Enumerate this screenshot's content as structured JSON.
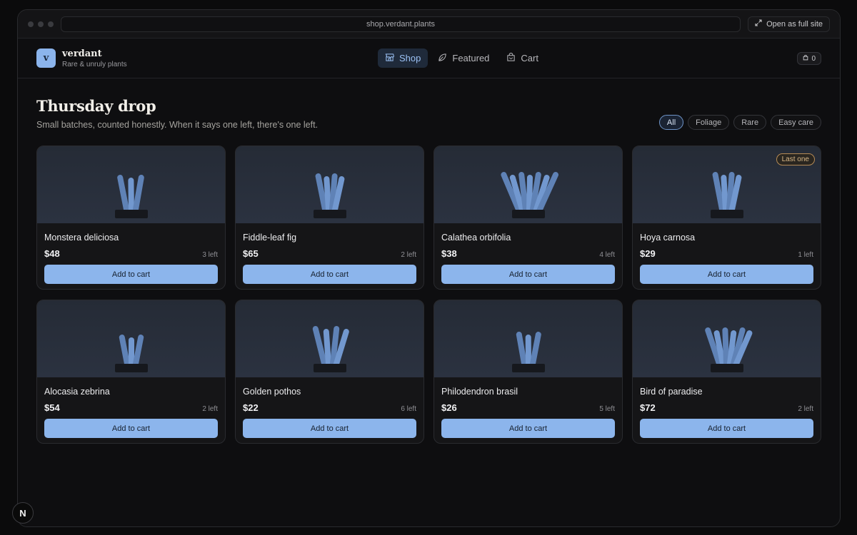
{
  "browser": {
    "url": "shop.verdant.plants",
    "open_full_label": "Open as full site"
  },
  "brand": {
    "logo_letter": "v",
    "name": "verdant",
    "tagline": "Rare & unruly plants"
  },
  "nav": {
    "shop": "Shop",
    "featured": "Featured",
    "cart": "Cart"
  },
  "cart_count": "0",
  "page": {
    "title": "Thursday drop",
    "subtitle": "Small batches, counted honestly. When it says one left, there's one left."
  },
  "filters": [
    "All",
    "Foliage",
    "Rare",
    "Easy care"
  ],
  "add_label": "Add to cart",
  "products": [
    {
      "name": "Monstera deliciosa",
      "price": "$48",
      "stock": "3 left",
      "badge": ""
    },
    {
      "name": "Fiddle-leaf fig",
      "price": "$65",
      "stock": "2 left",
      "badge": ""
    },
    {
      "name": "Calathea orbifolia",
      "price": "$38",
      "stock": "4 left",
      "badge": ""
    },
    {
      "name": "Hoya carnosa",
      "price": "$29",
      "stock": "1 left",
      "badge": "Last one"
    },
    {
      "name": "Alocasia zebrina",
      "price": "$54",
      "stock": "2 left",
      "badge": ""
    },
    {
      "name": "Golden pothos",
      "price": "$22",
      "stock": "6 left",
      "badge": ""
    },
    {
      "name": "Philodendron brasil",
      "price": "$26",
      "stock": "5 left",
      "badge": ""
    },
    {
      "name": "Bird of paradise",
      "price": "$72",
      "stock": "2 left",
      "badge": ""
    }
  ],
  "dev_badge": "N",
  "colors": {
    "accent": "#8cb5ec",
    "background": "#0e0e10",
    "card": "#151517",
    "badge": "#d9b887"
  }
}
